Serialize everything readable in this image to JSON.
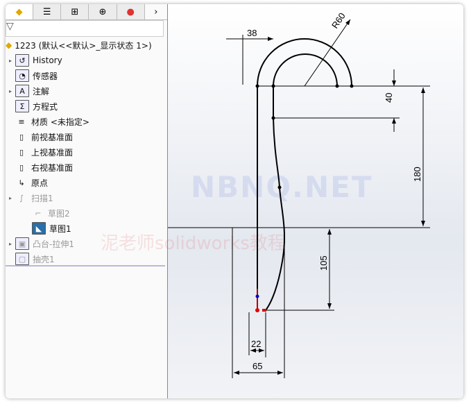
{
  "tabs": [
    {
      "icon": "feature-manager-icon"
    },
    {
      "icon": "property-manager-icon"
    },
    {
      "icon": "configuration-manager-icon"
    },
    {
      "icon": "dimxpert-icon"
    },
    {
      "icon": "display-manager-icon"
    }
  ],
  "tabs_more": "›",
  "filter_icon": "filter-icon",
  "tree": {
    "root": "1223  (默认<<默认>_显示状态 1>)",
    "items": [
      {
        "label": "History",
        "icon": "history-folder-icon",
        "expand": true
      },
      {
        "label": "传感器",
        "icon": "sensor-folder-icon"
      },
      {
        "label": "注解",
        "icon": "annotation-folder-icon",
        "expand": true
      },
      {
        "label": "方程式",
        "icon": "equation-folder-icon"
      },
      {
        "label": "材质 <未指定>",
        "icon": "material-icon"
      },
      {
        "label": "前视基准面",
        "icon": "plane-icon"
      },
      {
        "label": "上视基准面",
        "icon": "plane-icon"
      },
      {
        "label": "右视基准面",
        "icon": "plane-icon"
      },
      {
        "label": "原点",
        "icon": "origin-icon"
      },
      {
        "label": "扫描1",
        "icon": "sweep-icon",
        "expand": true,
        "dim": true
      },
      {
        "label": "草图2",
        "icon": "sketch-icon",
        "dim": true,
        "indent": true
      },
      {
        "label": "草图1",
        "icon": "active-sketch-icon",
        "indent": true
      },
      {
        "label": "凸台-拉伸1",
        "icon": "extrude-icon",
        "expand": true,
        "dim": true
      },
      {
        "label": "抽壳1",
        "icon": "shell-icon",
        "dim": true
      }
    ]
  },
  "sketch": {
    "dims": {
      "d38": "38",
      "r60": "R60",
      "d40": "40",
      "d180": "180",
      "d105": "105",
      "d22": "22",
      "d65": "65"
    }
  },
  "watermark": {
    "line1": "NBNQ.NET",
    "line2": "泥老师solidworks教程"
  }
}
